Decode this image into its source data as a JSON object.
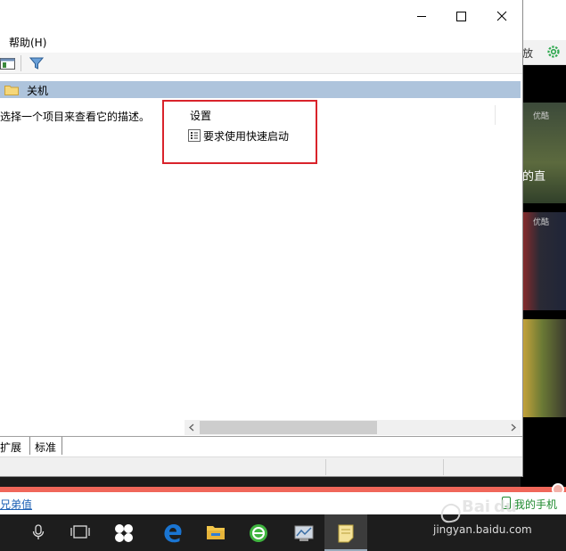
{
  "window": {
    "menu": {
      "help": "帮助(H)"
    },
    "tree": {
      "folder_label": "关机"
    },
    "description": "选择一个项目来查看它的描述。",
    "list": {
      "column_header": "设置",
      "setting_label": "要求使用快速启动"
    },
    "tabs": {
      "extended": "扩展",
      "standard": "标准"
    }
  },
  "background": {
    "toolbar_text": "放",
    "thumb1_caption": "的直",
    "thumb1_tiny": "优酷",
    "thumb2_tiny": "优酷",
    "brother_link": "兄弟值",
    "my_phone": "我的手机"
  },
  "watermark": {
    "site": "jingyan.baidu.com"
  },
  "colors": {
    "highlight": "#d9232b",
    "tree_header": "#aec4dc",
    "link": "#1a5fb4",
    "ribbon": "#f0675a"
  }
}
